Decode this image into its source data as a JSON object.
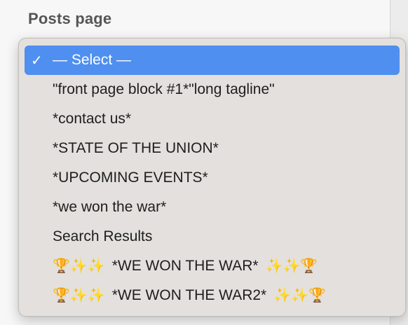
{
  "field": {
    "label": "Posts page"
  },
  "dropdown": {
    "selected_index": 0,
    "check_glyph": "✓",
    "options": [
      {
        "label": "— Select —"
      },
      {
        "label": "\"front page block #1*\"long tagline\""
      },
      {
        "label": "*contact us*"
      },
      {
        "label": "*STATE OF THE UNION*"
      },
      {
        "label": "*UPCOMING EVENTS*"
      },
      {
        "label": "*we won the war*"
      },
      {
        "label": "Search Results"
      },
      {
        "label": "*WE WON THE WAR*",
        "emoji_lead": "🏆✨✨",
        "emoji_tail": "✨✨🏆"
      },
      {
        "label": "*WE WON THE WAR2*",
        "emoji_lead": "🏆✨✨",
        "emoji_tail": "✨✨🏆"
      }
    ]
  },
  "colors": {
    "selection": "#4f8ff0",
    "menu_background": "#e3e0dd",
    "label_text": "#555555"
  }
}
